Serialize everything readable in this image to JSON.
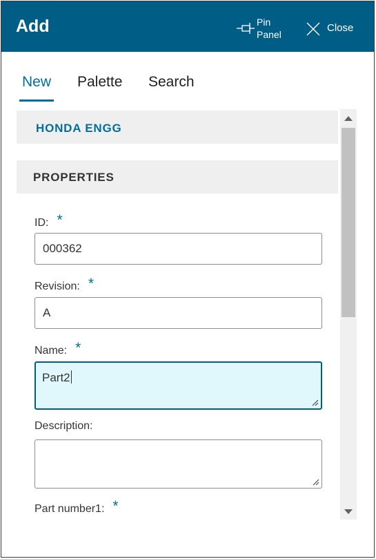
{
  "header": {
    "title": "Add",
    "pin_label_line1": "Pin",
    "pin_label_line2": "Panel",
    "close_label": "Close"
  },
  "tabs": [
    {
      "label": "New",
      "active": true
    },
    {
      "label": "Palette",
      "active": false
    },
    {
      "label": "Search",
      "active": false
    }
  ],
  "company": {
    "label": "HONDA ENGG"
  },
  "properties": {
    "heading": "PROPERTIES",
    "required_marker": "*",
    "fields": {
      "id": {
        "label": "ID:",
        "value": "000362",
        "required": true
      },
      "revision": {
        "label": "Revision:",
        "value": "A",
        "required": true
      },
      "name": {
        "label": "Name:",
        "value": "Part2",
        "required": true
      },
      "description": {
        "label": "Description:",
        "value": "",
        "required": false
      },
      "part_number1": {
        "label": "Part number1:",
        "value": "",
        "required": true
      }
    }
  },
  "colors": {
    "header_bg": "#005e86",
    "accent": "#00709b",
    "focused_field_bg": "#e0f8fc",
    "section_bg": "#efefef"
  }
}
